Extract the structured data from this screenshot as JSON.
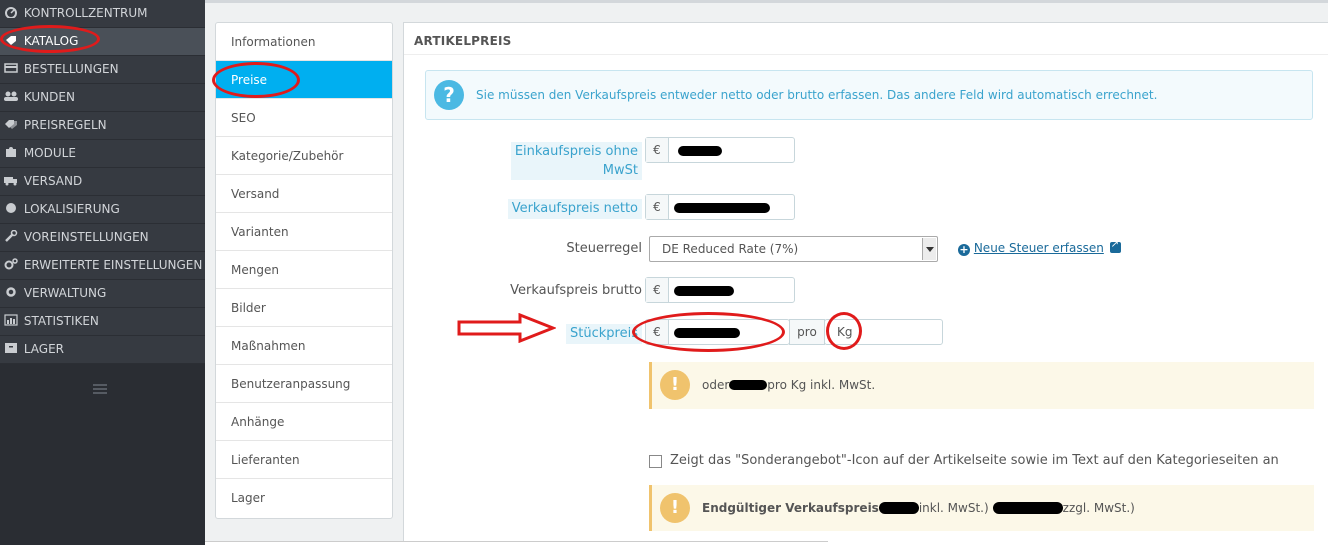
{
  "sidebar": {
    "items": [
      {
        "label": "KONTROLLZENTRUM",
        "icon": "dashboard-icon"
      },
      {
        "label": "KATALOG",
        "icon": "tag-icon",
        "active": true
      },
      {
        "label": "BESTELLUNGEN",
        "icon": "credit-card-icon"
      },
      {
        "label": "KUNDEN",
        "icon": "users-icon"
      },
      {
        "label": "PREISREGELN",
        "icon": "tags-icon"
      },
      {
        "label": "MODULE",
        "icon": "puzzle-icon"
      },
      {
        "label": "VERSAND",
        "icon": "truck-icon"
      },
      {
        "label": "LOKALISIERUNG",
        "icon": "globe-icon"
      },
      {
        "label": "VOREINSTELLUNGEN",
        "icon": "wrench-icon"
      },
      {
        "label": "ERWEITERTE EINSTELLUNGEN",
        "icon": "cogs-icon"
      },
      {
        "label": "VERWALTUNG",
        "icon": "cog-icon"
      },
      {
        "label": "STATISTIKEN",
        "icon": "bar-chart-icon"
      },
      {
        "label": "LAGER",
        "icon": "archive-icon"
      }
    ]
  },
  "tabs": [
    "Informationen",
    "Preise",
    "SEO",
    "Kategorie/Zubehör",
    "Versand",
    "Varianten",
    "Mengen",
    "Bilder",
    "Maßnahmen",
    "Benutzeranpassung",
    "Anhänge",
    "Lieferanten",
    "Lager"
  ],
  "active_tab": "Preise",
  "panel": {
    "title": "ARTIKELPREIS",
    "info": "Sie müssen den Verkaufspreis entweder netto oder brutto erfassen. Das andere Feld wird automatisch errechnet.",
    "fields": {
      "wholesale_label_1": "Einkaufspreis ohne",
      "wholesale_label_2": "MwSt",
      "net_label": "Verkaufspreis netto",
      "tax_label": "Steuerregel",
      "tax_value": "DE Reduced Rate (7%)",
      "new_tax_link": "Neue Steuer erfassen",
      "gross_label": "Verkaufspreis brutto",
      "unit_label": "Stückpreis",
      "unit_per": "pro",
      "unit_value": "Kg",
      "currency": "€"
    },
    "unit_notice_prefix": "oder",
    "unit_notice_suffix": "pro Kg inkl. MwSt.",
    "special_label": "Zeigt das \"Sonderangebot\"-Icon auf der Artikelseite sowie im Text auf den Kategorieseiten an",
    "final_price_label": "Endgültiger Verkaufspreis",
    "final_price_incl": "inkl. MwSt.)",
    "final_price_excl": "zzgl. MwSt.)"
  },
  "colors": {
    "sidebar_bg": "#363a41",
    "active_tab": "#00aff0",
    "info_text": "#3aa3cd",
    "warning": "#f0c36d",
    "annotation_red": "#e01b1b"
  }
}
